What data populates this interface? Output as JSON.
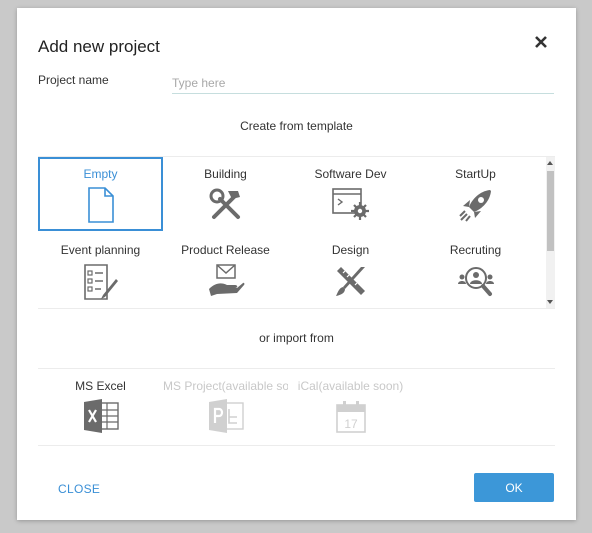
{
  "dialog": {
    "title": "Add new project",
    "close_icon": "close-icon"
  },
  "project_name": {
    "label": "Project name",
    "value": "",
    "placeholder": "Type here"
  },
  "templates": {
    "heading": "Create from template",
    "items": [
      {
        "label": "Empty",
        "icon": "blank-document-icon",
        "selected": true
      },
      {
        "label": "Building",
        "icon": "hammer-wrench-icon"
      },
      {
        "label": "Software Dev",
        "icon": "code-window-gear-icon"
      },
      {
        "label": "StartUp",
        "icon": "rocket-icon"
      },
      {
        "label": "Event planning",
        "icon": "checklist-pencil-icon"
      },
      {
        "label": "Product Release",
        "icon": "envelope-hand-icon"
      },
      {
        "label": "Design",
        "icon": "ruler-brush-icon"
      },
      {
        "label": "Recruting",
        "icon": "people-magnifier-icon"
      }
    ]
  },
  "imports": {
    "heading": "or import from",
    "items": [
      {
        "label": "MS Excel",
        "icon": "excel-icon",
        "enabled": true
      },
      {
        "label": "MS Project(available soon)",
        "icon": "ms-project-icon",
        "enabled": false
      },
      {
        "label": "iCal(available soon)",
        "icon": "calendar-icon",
        "enabled": false
      }
    ]
  },
  "footer": {
    "close_label": "CLOSE",
    "ok_label": "OK"
  },
  "colors": {
    "accent": "#3a8fd6",
    "ok_button": "#3c97d8",
    "icon": "#6b6b6b",
    "disabled": "#c8c8c8"
  }
}
